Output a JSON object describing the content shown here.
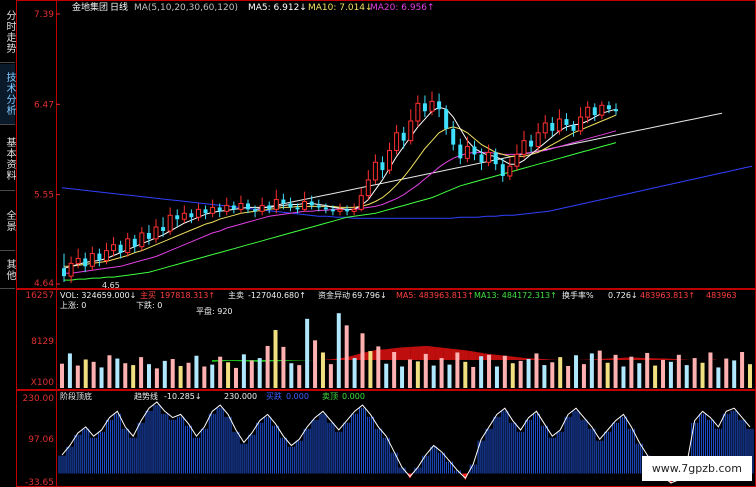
{
  "sidebar": {
    "tabs": [
      {
        "label": "分时走势",
        "active": false
      },
      {
        "label": "技术分析",
        "active": true
      },
      {
        "label": "基本资料",
        "active": false
      },
      {
        "label": "全景",
        "active": false
      },
      {
        "label": "其他",
        "active": false
      }
    ]
  },
  "watermark": "www.7gpzb.com",
  "colors": {
    "up": "#ff3030",
    "down": "#40e0ff",
    "ma5": "#ffffff",
    "ma10": "#f0e060",
    "ma20": "#e040e0",
    "ma60": "#40ff40",
    "long_line": "#3040ff",
    "axis_text": "#e03030",
    "border": "#c00000"
  },
  "chart_data": [
    {
      "type": "candlestick",
      "panel": "price",
      "header": {
        "title": "金地集团",
        "period": "日线",
        "ma_param": "MA(5,10,20,30,60,120)",
        "ma5": "MA5: 6.912↓",
        "ma10": "MA10: 7.014↓",
        "ma20": "MA20: 6.956↑"
      },
      "y_ticks": [
        "7.39",
        "6.47",
        "5.55",
        "4.64"
      ],
      "ylim": [
        4.64,
        7.39
      ],
      "low_annotation": "4.65",
      "candles": [
        [
          4.8,
          4.72,
          4.95,
          4.66
        ],
        [
          4.72,
          4.85,
          4.92,
          4.65
        ],
        [
          4.85,
          4.9,
          5.0,
          4.8
        ],
        [
          4.9,
          4.82,
          4.96,
          4.76
        ],
        [
          4.82,
          4.95,
          5.02,
          4.78
        ],
        [
          4.95,
          4.88,
          5.0,
          4.82
        ],
        [
          4.88,
          4.98,
          5.06,
          4.84
        ],
        [
          4.98,
          5.04,
          5.12,
          4.92
        ],
        [
          5.04,
          4.96,
          5.08,
          4.9
        ],
        [
          4.96,
          5.1,
          5.16,
          4.92
        ],
        [
          5.1,
          5.02,
          5.14,
          4.96
        ],
        [
          5.02,
          5.16,
          5.22,
          4.98
        ],
        [
          5.16,
          5.1,
          5.24,
          5.04
        ],
        [
          5.1,
          5.22,
          5.3,
          5.06
        ],
        [
          5.22,
          5.18,
          5.32,
          5.12
        ],
        [
          5.18,
          5.34,
          5.42,
          5.14
        ],
        [
          5.34,
          5.3,
          5.4,
          5.22
        ],
        [
          5.3,
          5.36,
          5.44,
          5.26
        ],
        [
          5.36,
          5.32,
          5.4,
          5.26
        ],
        [
          5.32,
          5.4,
          5.46,
          5.28
        ],
        [
          5.4,
          5.36,
          5.44,
          5.3
        ],
        [
          5.36,
          5.42,
          5.5,
          5.32
        ],
        [
          5.42,
          5.38,
          5.46,
          5.32
        ],
        [
          5.38,
          5.44,
          5.52,
          5.34
        ],
        [
          5.44,
          5.4,
          5.48,
          5.36
        ],
        [
          5.4,
          5.46,
          5.54,
          5.36
        ],
        [
          5.46,
          5.4,
          5.5,
          5.36
        ],
        [
          5.4,
          5.38,
          5.44,
          5.32
        ],
        [
          5.38,
          5.44,
          5.52,
          5.34
        ],
        [
          5.44,
          5.4,
          5.48,
          5.36
        ],
        [
          5.4,
          5.5,
          5.6,
          5.36
        ],
        [
          5.5,
          5.46,
          5.56,
          5.4
        ],
        [
          5.46,
          5.42,
          5.52,
          5.38
        ],
        [
          5.42,
          5.4,
          5.46,
          5.36
        ],
        [
          5.4,
          5.48,
          5.58,
          5.38
        ],
        [
          5.48,
          5.44,
          5.54,
          5.4
        ],
        [
          5.44,
          5.42,
          5.5,
          5.38
        ],
        [
          5.42,
          5.4,
          5.46,
          5.36
        ],
        [
          5.4,
          5.38,
          5.44,
          5.34
        ],
        [
          5.38,
          5.4,
          5.46,
          5.34
        ],
        [
          5.4,
          5.38,
          5.44,
          5.34
        ],
        [
          5.38,
          5.4,
          5.46,
          5.34
        ],
        [
          5.4,
          5.54,
          5.62,
          5.38
        ],
        [
          5.54,
          5.7,
          5.8,
          5.5
        ],
        [
          5.7,
          5.88,
          5.96,
          5.66
        ],
        [
          5.88,
          5.8,
          5.94,
          5.72
        ],
        [
          5.8,
          6.0,
          6.08,
          5.76
        ],
        [
          6.0,
          6.18,
          6.26,
          5.96
        ],
        [
          6.18,
          6.1,
          6.24,
          6.02
        ],
        [
          6.1,
          6.3,
          6.42,
          6.06
        ],
        [
          6.3,
          6.48,
          6.56,
          6.24
        ],
        [
          6.48,
          6.4,
          6.56,
          6.34
        ],
        [
          6.4,
          6.5,
          6.6,
          6.36
        ],
        [
          6.5,
          6.42,
          6.58,
          6.34
        ],
        [
          6.42,
          6.22,
          6.46,
          6.16
        ],
        [
          6.22,
          6.06,
          6.3,
          6.0
        ],
        [
          6.06,
          5.92,
          6.12,
          5.86
        ],
        [
          5.92,
          6.04,
          6.14,
          5.88
        ],
        [
          6.04,
          5.96,
          6.1,
          5.9
        ],
        [
          5.96,
          5.88,
          6.02,
          5.8
        ],
        [
          5.88,
          5.98,
          6.06,
          5.84
        ],
        [
          5.98,
          5.86,
          6.02,
          5.8
        ],
        [
          5.86,
          5.74,
          5.92,
          5.68
        ],
        [
          5.74,
          5.84,
          5.92,
          5.7
        ],
        [
          5.84,
          5.96,
          6.06,
          5.8
        ],
        [
          5.96,
          6.1,
          6.2,
          5.92
        ],
        [
          6.1,
          6.04,
          6.16,
          5.98
        ],
        [
          6.04,
          6.18,
          6.28,
          6.0
        ],
        [
          6.18,
          6.28,
          6.36,
          6.12
        ],
        [
          6.28,
          6.2,
          6.34,
          6.14
        ],
        [
          6.2,
          6.32,
          6.42,
          6.16
        ],
        [
          6.32,
          6.26,
          6.38,
          6.2
        ],
        [
          6.26,
          6.2,
          6.3,
          6.14
        ],
        [
          6.2,
          6.34,
          6.44,
          6.16
        ],
        [
          6.34,
          6.44,
          6.5,
          6.28
        ],
        [
          6.44,
          6.36,
          6.48,
          6.3
        ],
        [
          6.36,
          6.46,
          6.5,
          6.32
        ],
        [
          6.46,
          6.42,
          6.5,
          6.38
        ],
        [
          6.42,
          6.4,
          6.48,
          6.36
        ]
      ],
      "ma5": [
        4.8,
        4.82,
        4.84,
        4.86,
        4.87,
        4.88,
        4.9,
        4.93,
        4.96,
        4.99,
        5.02,
        5.05,
        5.08,
        5.11,
        5.14,
        5.18,
        5.22,
        5.26,
        5.29,
        5.32,
        5.35,
        5.37,
        5.38,
        5.39,
        5.4,
        5.41,
        5.42,
        5.42,
        5.42,
        5.42,
        5.43,
        5.44,
        5.45,
        5.45,
        5.46,
        5.46,
        5.45,
        5.44,
        5.42,
        5.41,
        5.4,
        5.4,
        5.44,
        5.5,
        5.6,
        5.7,
        5.82,
        5.94,
        6.04,
        6.14,
        6.24,
        6.32,
        6.4,
        6.44,
        6.42,
        6.34,
        6.22,
        6.1,
        6.02,
        5.98,
        5.95,
        5.94,
        5.9,
        5.86,
        5.86,
        5.9,
        5.96,
        6.02,
        6.08,
        6.14,
        6.2,
        6.24,
        6.26,
        6.27,
        6.3,
        6.34,
        6.38,
        6.4,
        6.42
      ],
      "ma10": [
        4.82,
        4.82,
        4.83,
        4.84,
        4.85,
        4.86,
        4.87,
        4.89,
        4.91,
        4.93,
        4.96,
        4.98,
        5.01,
        5.04,
        5.07,
        5.1,
        5.13,
        5.16,
        5.19,
        5.22,
        5.25,
        5.27,
        5.3,
        5.32,
        5.34,
        5.36,
        5.37,
        5.38,
        5.39,
        5.4,
        5.41,
        5.42,
        5.42,
        5.43,
        5.43,
        5.43,
        5.43,
        5.43,
        5.43,
        5.42,
        5.42,
        5.42,
        5.43,
        5.45,
        5.48,
        5.52,
        5.58,
        5.65,
        5.73,
        5.82,
        5.92,
        6.02,
        6.1,
        6.18,
        6.22,
        6.24,
        6.22,
        6.18,
        6.12,
        6.06,
        6.02,
        5.98,
        5.96,
        5.94,
        5.94,
        5.94,
        5.96,
        5.98,
        6.02,
        6.06,
        6.1,
        6.14,
        6.18,
        6.21,
        6.24,
        6.27,
        6.3,
        6.33,
        6.36
      ],
      "ma20": [
        4.75,
        4.75,
        4.76,
        4.77,
        4.78,
        4.79,
        4.8,
        4.81,
        4.82,
        4.84,
        4.86,
        4.88,
        4.9,
        4.92,
        4.95,
        4.98,
        5.01,
        5.04,
        5.07,
        5.1,
        5.13,
        5.16,
        5.18,
        5.21,
        5.23,
        5.25,
        5.27,
        5.29,
        5.31,
        5.33,
        5.34,
        5.35,
        5.36,
        5.37,
        5.38,
        5.38,
        5.39,
        5.39,
        5.4,
        5.4,
        5.4,
        5.4,
        5.41,
        5.42,
        5.43,
        5.45,
        5.48,
        5.51,
        5.55,
        5.6,
        5.65,
        5.71,
        5.77,
        5.83,
        5.88,
        5.92,
        5.95,
        5.97,
        5.98,
        5.98,
        5.98,
        5.97,
        5.96,
        5.96,
        5.96,
        5.97,
        5.98,
        5.99,
        6.0,
        6.02,
        6.04,
        6.06,
        6.08,
        6.1,
        6.12,
        6.14,
        6.16,
        6.18,
        6.2
      ],
      "ma60": [
        4.68,
        4.68,
        4.69,
        4.69,
        4.7,
        4.7,
        4.71,
        4.71,
        4.72,
        4.73,
        4.74,
        4.75,
        4.76,
        4.78,
        4.8,
        4.82,
        4.84,
        4.86,
        4.88,
        4.9,
        4.92,
        4.94,
        4.96,
        4.98,
        5.0,
        5.02,
        5.04,
        5.06,
        5.08,
        5.1,
        5.12,
        5.14,
        5.16,
        5.18,
        5.2,
        5.22,
        5.24,
        5.26,
        5.28,
        5.3,
        5.32,
        5.33,
        5.34,
        5.35,
        5.36,
        5.38,
        5.4,
        5.42,
        5.44,
        5.46,
        5.48,
        5.5,
        5.52,
        5.55,
        5.58,
        5.61,
        5.64,
        5.66,
        5.68,
        5.7,
        5.72,
        5.74,
        5.76,
        5.78,
        5.8,
        5.82,
        5.84,
        5.86,
        5.88,
        5.9,
        5.92,
        5.94,
        5.96,
        5.98,
        6.0,
        6.02,
        6.04,
        6.06,
        6.08
      ],
      "long_line": [
        5.62,
        5.61,
        5.6,
        5.59,
        5.58,
        5.57,
        5.56,
        5.55,
        5.54,
        5.53,
        5.52,
        5.51,
        5.5,
        5.49,
        5.48,
        5.47,
        5.46,
        5.45,
        5.44,
        5.43,
        5.42,
        5.41,
        5.4,
        5.39,
        5.38,
        5.37,
        5.36,
        5.35,
        5.34,
        5.33,
        5.33,
        5.32,
        5.32,
        5.31,
        5.31,
        5.31,
        5.31,
        5.31,
        5.31,
        5.31,
        5.31,
        5.31,
        5.31,
        5.31,
        5.31,
        5.32,
        5.32,
        5.32,
        5.33,
        5.33,
        5.34,
        5.34,
        5.35,
        5.36,
        5.37,
        5.38,
        5.4,
        5.42,
        5.44,
        5.46,
        5.48,
        5.5,
        5.52,
        5.54,
        5.56,
        5.58,
        5.6,
        5.62,
        5.64,
        5.66,
        5.68,
        5.7,
        5.72,
        5.74,
        5.76,
        5.78,
        5.8,
        5.82,
        5.84
      ],
      "white_trend": [
        5.4,
        5.42,
        5.44,
        5.46,
        5.48,
        5.5,
        5.52,
        5.54,
        5.56,
        5.58,
        5.6,
        5.62,
        5.64,
        5.66,
        5.68,
        5.7,
        5.72,
        5.74,
        5.76,
        5.78,
        5.8,
        5.82,
        5.84,
        5.86,
        5.88,
        5.9,
        5.92,
        5.94,
        5.96,
        5.98,
        6.0,
        6.02,
        6.04,
        6.06,
        6.08,
        6.1,
        6.12,
        6.14,
        6.16,
        6.18,
        6.2,
        6.22,
        6.24,
        6.26,
        6.28,
        6.3,
        6.32,
        6.34,
        6.36,
        6.38
      ]
    },
    {
      "type": "bar",
      "panel": "volume",
      "header": {
        "vol": "VOL: 324659.000↓",
        "main_label": "主买",
        "main_value": "197818.313↑",
        "main_sell_label": "主卖",
        "main_sell_value": "-127040.680↑",
        "fund_label": "资金异动",
        "fund_value": "69.796↓",
        "ma5": "MA5: 483963.813↑",
        "ma13": "MA13: 484172.313↑",
        "turnover_label": "换手率%",
        "turnover_value": "0.726↓",
        "extra": "483963.813↑",
        "extra2": "483963"
      },
      "sub_labels": {
        "up": "上涨: 0",
        "down": "下跌: 0",
        "flat": "平盘: 920"
      },
      "y_ticks": [
        "16257",
        "8129",
        "X100"
      ],
      "ylim": [
        0,
        16257
      ],
      "values": [
        5200,
        7400,
        4800,
        6100,
        5600,
        4400,
        7000,
        6300,
        5300,
        4900,
        6600,
        5100,
        4200,
        5800,
        6200,
        4700,
        5400,
        6900,
        4600,
        5000,
        6700,
        5500,
        4300,
        7200,
        5900,
        6400,
        9000,
        12400,
        8800,
        5300,
        4900,
        14800,
        10200,
        7600,
        5100,
        16000,
        13400,
        6400,
        11700,
        7900,
        8900,
        5200,
        7700,
        4600,
        6100,
        5700,
        7300,
        4800,
        6400,
        5000,
        7600,
        5600,
        4500,
        6800,
        7100,
        4600,
        6900,
        5300,
        5800,
        6200,
        7400,
        4900,
        5500,
        6600,
        4700,
        7000,
        5100,
        7400,
        8000,
        5400,
        7100,
        4600,
        6700,
        5300,
        7500,
        4800,
        6000,
        5600,
        7100,
        4900,
        6400,
        5400,
        7600,
        4400,
        6300,
        5900,
        7700,
        5100
      ],
      "ma_fill": [
        5600,
        5700,
        5800,
        5750,
        5700,
        5650,
        5600,
        5700,
        5750,
        5800,
        5850,
        5900,
        5950,
        6000,
        6100,
        6250,
        6500,
        6900,
        7400,
        7800,
        8200,
        8300,
        8500,
        8700,
        8800,
        8900,
        9000,
        8800,
        8600,
        8400,
        8200,
        8000,
        7700,
        7400,
        7200,
        7000,
        6800,
        6600,
        6400,
        6300,
        6200,
        6100,
        6000,
        6000,
        6000,
        6050,
        6100,
        6200,
        6300,
        6400,
        6500,
        6500,
        6450,
        6400,
        6350,
        6300,
        6200,
        6100,
        6000,
        6000,
        6000,
        6100
      ]
    },
    {
      "type": "line",
      "panel": "indicator",
      "header": {
        "name": "阶段顶底",
        "trend_label": "趋势线",
        "trend_value": "-10.285↓",
        "value2": "230.000",
        "buy_label": "买跌",
        "buy_value": "0.000",
        "sell_label": "卖顶",
        "sell_value": "0.000"
      },
      "y_ticks": [
        "230.00",
        "97.06",
        "-33.65"
      ],
      "ylim": [
        -33.65,
        230.0
      ],
      "values": [
        60,
        90,
        130,
        150,
        120,
        140,
        180,
        200,
        150,
        120,
        170,
        210,
        230,
        200,
        180,
        190,
        160,
        120,
        150,
        200,
        220,
        190,
        140,
        100,
        130,
        170,
        190,
        160,
        120,
        90,
        110,
        150,
        180,
        200,
        170,
        140,
        170,
        200,
        220,
        190,
        150,
        120,
        70,
        20,
        -10,
        20,
        60,
        90,
        70,
        40,
        10,
        -15,
        30,
        110,
        150,
        190,
        210,
        170,
        140,
        180,
        200,
        160,
        120,
        140,
        190,
        210,
        180,
        150,
        110,
        140,
        170,
        190,
        150,
        100,
        60,
        20,
        -10,
        -30,
        -20,
        30,
        170,
        200,
        180,
        150,
        200,
        210,
        180,
        150
      ]
    }
  ]
}
